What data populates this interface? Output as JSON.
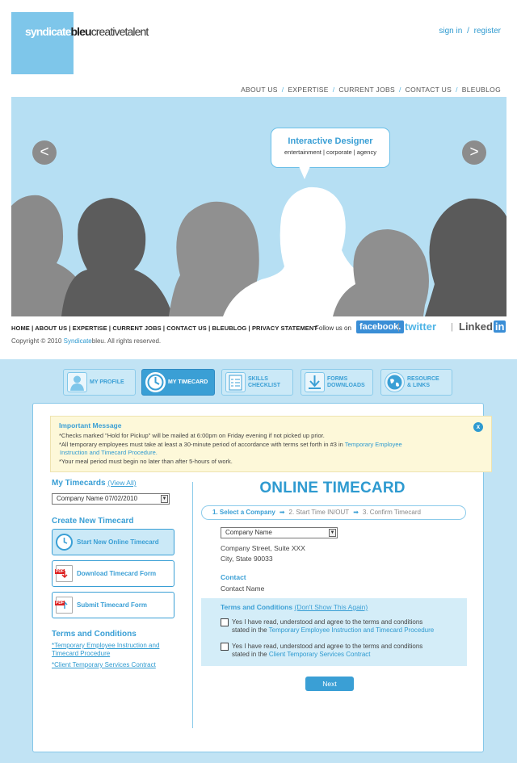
{
  "logo": {
    "part1": "syndicate",
    "part2": "bleu",
    "part3": "creativetalent"
  },
  "auth": {
    "signin": "sign in",
    "sep": "/",
    "register": "register"
  },
  "nav": [
    "ABOUT US",
    "EXPERTISE",
    "CURRENT JOBS",
    "CONTACT US",
    "BLEUBLOG"
  ],
  "hero": {
    "prev": "<",
    "next": ">",
    "bubble_title": "Interactive Designer",
    "bubble_sub": "entertainment | corporate | agency"
  },
  "footer": {
    "links": [
      "HOME",
      "ABOUT US",
      "EXPERTISE",
      "CURRENT JOBS",
      "CONTACT US",
      "BLEUBLOG",
      "PRIVACY STATEMENT"
    ],
    "follow": "Follow us on",
    "facebook": "facebook.",
    "twitter": "twitter",
    "linkedin": "Linked",
    "linkedin_in": "in",
    "copy_prefix": "Copyright © 2010 ",
    "copy_brand": "Syndicate",
    "copy_suffix": "bleu. All rights reserved."
  },
  "tabs": [
    {
      "label": "MY PROFILE"
    },
    {
      "label": "MY TIMECARD"
    },
    {
      "label": "SKILLS\nCHECKLIST"
    },
    {
      "label": "FORMS\nDOWNLOADS"
    },
    {
      "label": "RESOURCE\n& LINKS"
    }
  ],
  "message": {
    "heading": "Important Message",
    "line1": "*Checks marked \"Hold for Pickup\" will be mailed at 6:00pm on Friday evening if not picked up prior.",
    "line2": "*All temporary employees must take at least a 30-minute period of accordance with terms set forth in #3 in ",
    "line2_link": "Temporary Employee",
    "line3_link": "Instruction and Timecard Procedure.",
    "line4": "*Your meal period must begin no later than after 5-hours of work.",
    "close": "x"
  },
  "sidebar": {
    "my_timecards": "My Timecards",
    "view_all": "(View All)",
    "timecard_select": "Company Name 07/02/2010",
    "create_heading": "Create New Timecard",
    "btn_start": "Start New Online Timecard",
    "btn_download": "Download Timecard Form",
    "btn_submit": "Submit Timecard Form",
    "terms_heading": "Terms and Conditions",
    "link1a": "*Temporary Employee Instruction and",
    "link1b": "Timecard Procedure",
    "link2": "*Client Temporary Services Contract"
  },
  "main": {
    "title": "ONLINE TIMECARD",
    "step1": "1. Select a Company",
    "step2": "2. Start Time IN/OUT",
    "step3": "3. Confirm Timecard",
    "arrow": "➡",
    "company_select": "Company Name",
    "street": "Company Street, Suite XXX",
    "city": "City, State 90033",
    "contact_heading": "Contact",
    "contact_name": "Contact Name",
    "terms_heading": "Terms and Conditions",
    "terms_toggle": "(Don't Show This Again)",
    "agree1_text": "Yes I have read, understood and agree to the terms and conditions",
    "agree1_pre": "stated in the ",
    "agree1_link": "Temporary Employee Instruction and Timecard Procedure",
    "agree2_text": "Yes I have read, understood and agree to the terms and conditions",
    "agree2_pre": "stated in the ",
    "agree2_link": "Client Temporary Services Contract",
    "next": "Next"
  }
}
